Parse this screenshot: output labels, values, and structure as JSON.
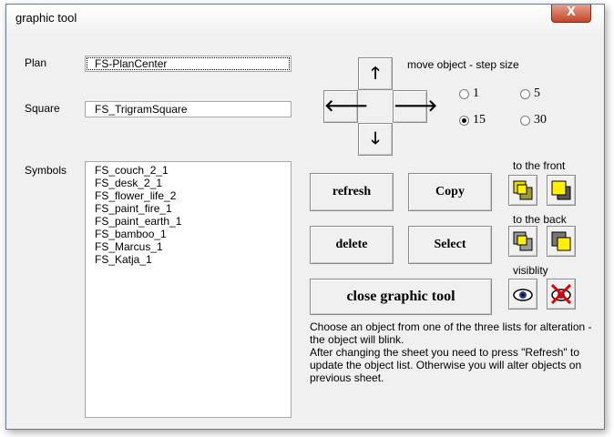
{
  "window": {
    "title": "graphic tool",
    "close_glyph": "X"
  },
  "plan": {
    "label": "Plan",
    "value": "FS-PlanCenter"
  },
  "square": {
    "label": "Square",
    "value": "FS_TrigramSquare"
  },
  "symbols": {
    "label": "Symbols",
    "items": [
      "FS_couch_2_1",
      "FS_desk_2_1",
      "FS_flower_life_2",
      "FS_paint_fire_1",
      "FS_paint_earth_1",
      "FS_bamboo_1",
      "FS_Marcus_1",
      "FS_Katja_1"
    ]
  },
  "move": {
    "label": "move object - step size",
    "options": [
      {
        "label": "1",
        "selected": false
      },
      {
        "label": "5",
        "selected": false
      },
      {
        "label": "15",
        "selected": true
      },
      {
        "label": "30",
        "selected": false
      }
    ]
  },
  "buttons": {
    "refresh": "refresh",
    "copy": "Copy",
    "delete": "delete",
    "select": "Select",
    "close": "close graphic tool"
  },
  "labels": {
    "front": "to the front",
    "back": "to the back",
    "visibility": "visiblity"
  },
  "description": {
    "line1": "Choose an object from one of the three lists for alteration - the object will blink.",
    "line2": "After changing the sheet you need to press \"Refresh\" to update the object list. Otherwise you will alter objects on previous sheet."
  }
}
